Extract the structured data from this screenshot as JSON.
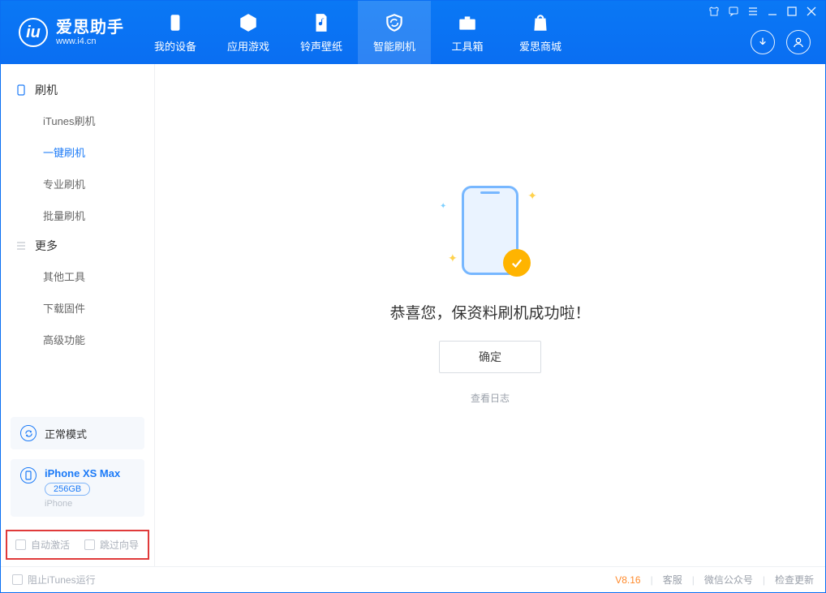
{
  "app": {
    "name_cn": "爱思助手",
    "url": "www.i4.cn"
  },
  "nav": {
    "items": [
      {
        "label": "我的设备"
      },
      {
        "label": "应用游戏"
      },
      {
        "label": "铃声壁纸"
      },
      {
        "label": "智能刷机"
      },
      {
        "label": "工具箱"
      },
      {
        "label": "爱思商城"
      }
    ]
  },
  "sidebar": {
    "group1_title": "刷机",
    "group1_items": [
      {
        "label": "iTunes刷机"
      },
      {
        "label": "一键刷机"
      },
      {
        "label": "专业刷机"
      },
      {
        "label": "批量刷机"
      }
    ],
    "group2_title": "更多",
    "group2_items": [
      {
        "label": "其他工具"
      },
      {
        "label": "下载固件"
      },
      {
        "label": "高级功能"
      }
    ],
    "mode_label": "正常模式",
    "device_name": "iPhone XS Max",
    "device_capacity": "256GB",
    "device_type": "iPhone",
    "chk_auto_activate": "自动激活",
    "chk_skip_guide": "跳过向导"
  },
  "main": {
    "success_text": "恭喜您，保资料刷机成功啦！",
    "ok_button": "确定",
    "view_log": "查看日志"
  },
  "footer": {
    "block_itunes": "阻止iTunes运行",
    "version": "V8.16",
    "support": "客服",
    "wechat": "微信公众号",
    "check_update": "检查更新"
  }
}
